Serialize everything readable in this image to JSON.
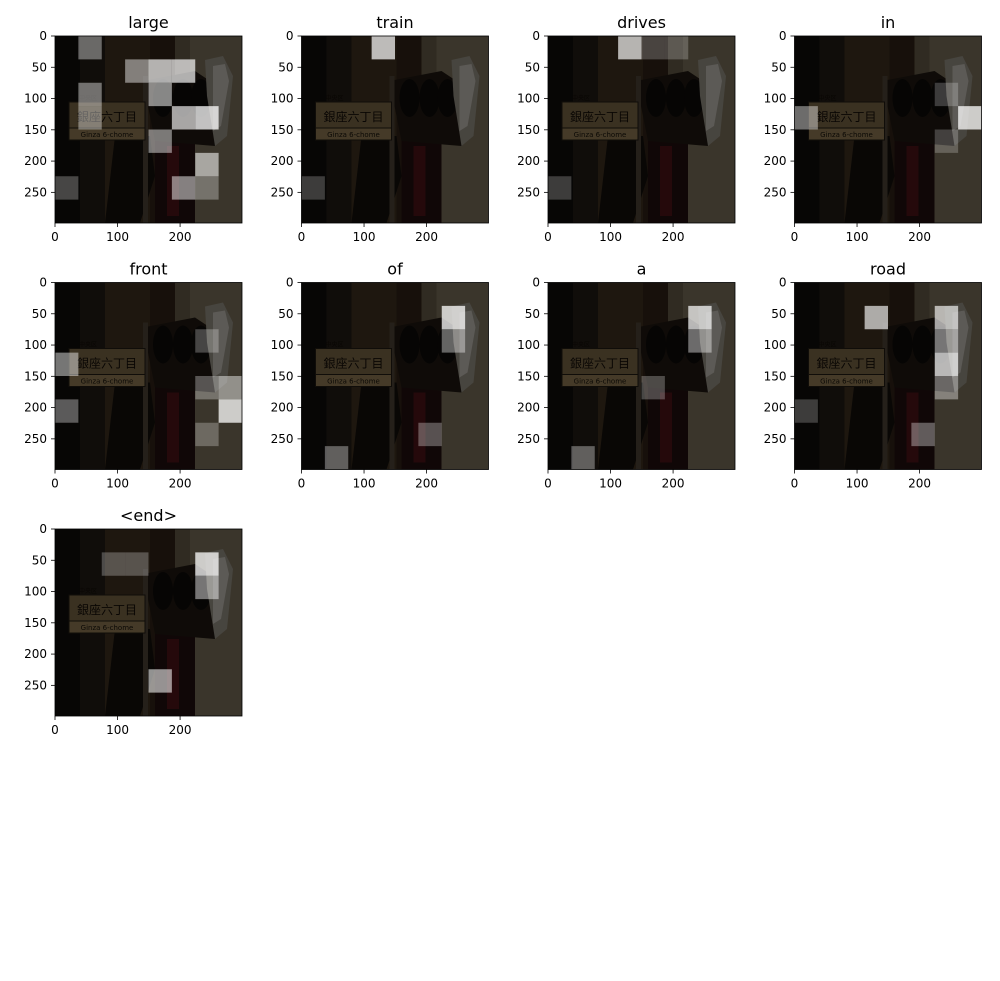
{
  "figure": {
    "type": "attention-visualization-grid",
    "image_description_source": "street scene with traffic signal and Japanese sign",
    "sign_text": {
      "main": "銀座六丁目",
      "sub": "Ginza 6-chome",
      "small": "中央区"
    },
    "panels": [
      {
        "word": "large",
        "hot_cells": [
          [
            0,
            1,
            0.5
          ],
          [
            1,
            4,
            0.9
          ],
          [
            1,
            5,
            0.9
          ],
          [
            1,
            3,
            0.6
          ],
          [
            2,
            1,
            0.55
          ],
          [
            2,
            4,
            0.7
          ],
          [
            3,
            5,
            0.85
          ],
          [
            3,
            6,
            1.0
          ],
          [
            3,
            1,
            0.5
          ],
          [
            4,
            4,
            0.6
          ],
          [
            5,
            6,
            0.75
          ],
          [
            6,
            0,
            0.35
          ],
          [
            6,
            5,
            0.65
          ],
          [
            6,
            6,
            0.4
          ]
        ]
      },
      {
        "word": "train",
        "hot_cells": [
          [
            0,
            3,
            0.95
          ],
          [
            6,
            0,
            0.3
          ]
        ]
      },
      {
        "word": "drives",
        "hot_cells": [
          [
            0,
            3,
            0.9
          ],
          [
            0,
            4,
            0.3
          ],
          [
            0,
            5,
            0.3
          ],
          [
            6,
            0,
            0.3
          ]
        ]
      },
      {
        "word": "in",
        "hot_cells": [
          [
            3,
            0,
            0.55
          ],
          [
            3,
            7,
            1.0
          ],
          [
            2,
            6,
            0.3
          ],
          [
            4,
            6,
            0.3
          ]
        ]
      },
      {
        "word": "front",
        "hot_cells": [
          [
            3,
            0,
            0.6
          ],
          [
            5,
            0,
            0.45
          ],
          [
            2,
            6,
            0.35
          ],
          [
            4,
            7,
            0.6
          ],
          [
            5,
            7,
            1.0
          ],
          [
            4,
            6,
            0.4
          ],
          [
            6,
            6,
            0.35
          ]
        ]
      },
      {
        "word": "of",
        "hot_cells": [
          [
            1,
            6,
            1.0
          ],
          [
            2,
            6,
            0.5
          ],
          [
            6,
            5,
            0.4
          ],
          [
            7,
            1,
            0.45
          ],
          [
            8,
            2,
            0.3
          ]
        ]
      },
      {
        "word": "a",
        "hot_cells": [
          [
            1,
            6,
            0.95
          ],
          [
            2,
            6,
            0.55
          ],
          [
            4,
            4,
            0.35
          ],
          [
            7,
            1,
            0.45
          ],
          [
            8,
            3,
            0.3
          ]
        ]
      },
      {
        "word": "road",
        "hot_cells": [
          [
            1,
            3,
            0.85
          ],
          [
            1,
            6,
            0.85
          ],
          [
            2,
            6,
            0.6
          ],
          [
            3,
            6,
            0.95
          ],
          [
            4,
            6,
            0.5
          ],
          [
            6,
            5,
            0.45
          ],
          [
            5,
            0,
            0.3
          ],
          [
            8,
            3,
            0.35
          ]
        ]
      },
      {
        "word": "<end>",
        "hot_cells": [
          [
            1,
            6,
            1.0
          ],
          [
            2,
            6,
            0.6
          ],
          [
            1,
            2,
            0.35
          ],
          [
            1,
            3,
            0.35
          ],
          [
            6,
            4,
            0.75
          ],
          [
            8,
            1,
            0.3
          ],
          [
            9,
            2,
            0.35
          ]
        ]
      }
    ],
    "axes": {
      "x_ticks": [
        "0",
        "100",
        "200"
      ],
      "y_ticks": [
        "0",
        "50",
        "100",
        "150",
        "200",
        "250"
      ],
      "xlim": [
        0,
        299
      ],
      "ylim_inverted": [
        299,
        0
      ]
    }
  }
}
